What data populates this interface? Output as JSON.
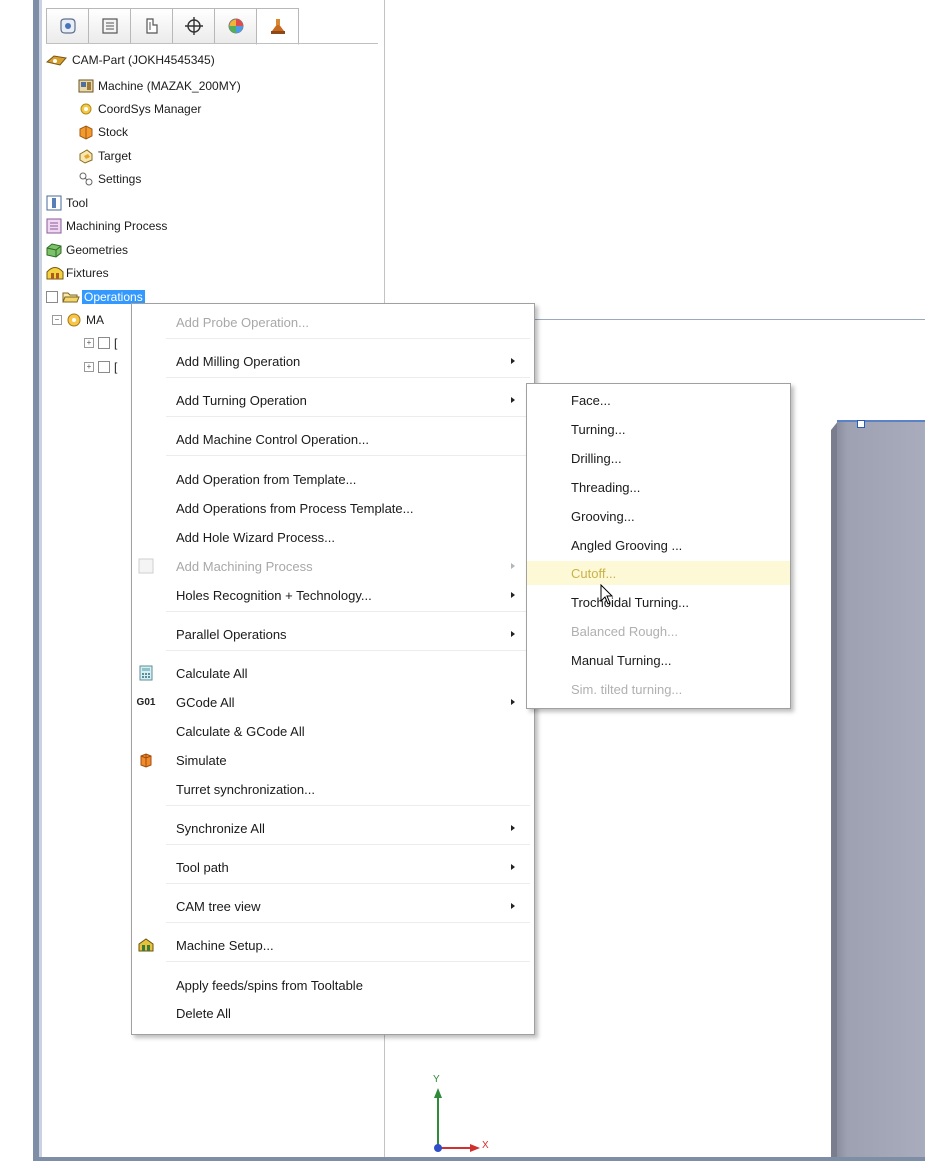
{
  "tree": {
    "tabs": [
      "feature-manager-icon",
      "property-manager-icon",
      "configuration-manager-icon",
      "dimxpert-icon",
      "appearance-icon",
      "cam-manager-icon"
    ],
    "items": [
      {
        "label": "CAM-Part (JOKH4545345)"
      },
      {
        "label": "Machine (MAZAK_200MY)"
      },
      {
        "label": "CoordSys Manager"
      },
      {
        "label": "Stock"
      },
      {
        "label": "Target"
      },
      {
        "label": "Settings"
      },
      {
        "label": "Tool"
      },
      {
        "label": "Machining Process"
      },
      {
        "label": "Geometries"
      },
      {
        "label": "Fixtures"
      },
      {
        "label": "Operations"
      },
      {
        "label": "MA"
      },
      {
        "label": "["
      },
      {
        "label": "["
      }
    ]
  },
  "context_menu": {
    "items": [
      {
        "label": "Add Probe Operation...",
        "disabled": true
      },
      {
        "label": "Add Milling Operation",
        "submenu": true
      },
      {
        "label": "Add Turning Operation",
        "submenu": true
      },
      {
        "label": "Add Machine Control Operation..."
      },
      {
        "label": "Add Operation from Template..."
      },
      {
        "label": "Add Operations from Process Template..."
      },
      {
        "label": "Add Hole Wizard Process..."
      },
      {
        "label": "Add Machining Process",
        "disabled": true,
        "submenu": true
      },
      {
        "label": "Holes Recognition + Technology...",
        "submenu": true
      },
      {
        "label": "Parallel Operations",
        "submenu": true
      },
      {
        "label": "Calculate All"
      },
      {
        "label": "GCode All",
        "submenu": true,
        "icon_text": "G01"
      },
      {
        "label": "Calculate & GCode All"
      },
      {
        "label": "Simulate"
      },
      {
        "label": "Turret synchronization..."
      },
      {
        "label": "Synchronize All",
        "submenu": true
      },
      {
        "label": "Tool path",
        "submenu": true
      },
      {
        "label": "CAM tree view",
        "submenu": true
      },
      {
        "label": "Machine Setup..."
      },
      {
        "label": "Apply feeds/spins from Tooltable"
      },
      {
        "label": "Delete All"
      }
    ]
  },
  "turning_submenu": {
    "items": [
      {
        "label": "Face..."
      },
      {
        "label": "Turning..."
      },
      {
        "label": "Drilling..."
      },
      {
        "label": "Threading..."
      },
      {
        "label": "Grooving..."
      },
      {
        "label": "Angled Grooving ..."
      },
      {
        "label": "Cutoff...",
        "hover": true
      },
      {
        "label": "Trochoidal Turning..."
      },
      {
        "label": "Balanced Rough...",
        "disabled": true
      },
      {
        "label": "Manual Turning..."
      },
      {
        "label": "Sim. tilted turning...",
        "disabled": true
      }
    ]
  },
  "triad": {
    "x_label": "X",
    "y_label": "Y"
  },
  "colors": {
    "selection": "#3399ff",
    "hover_bg": "#fdf9d6",
    "frame": "#7d8ea6",
    "part": "#a9acbd"
  }
}
